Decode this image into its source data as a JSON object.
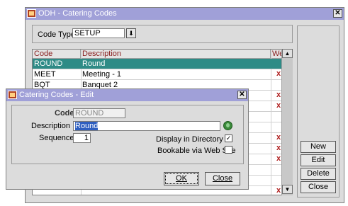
{
  "main_window": {
    "title": "ODH - Catering Codes",
    "close_glyph": "✕",
    "code_type": {
      "label": "Code Type",
      "value": "SETUP",
      "dropdown_glyph": "⬇"
    },
    "grid": {
      "columns": [
        "Code",
        "Description",
        "Web"
      ],
      "rows": [
        {
          "code": "ROUND",
          "description": "Round",
          "web": "",
          "selected": true
        },
        {
          "code": "MEET",
          "description": "Meeting - 1",
          "web": "x"
        },
        {
          "code": "BQT",
          "description": "Banquet 2",
          "web": ""
        },
        {
          "code": "",
          "description": "",
          "web": "x"
        },
        {
          "code": "",
          "description": "",
          "web": "x"
        },
        {
          "code": "",
          "description": "",
          "web": ""
        },
        {
          "code": "",
          "description": "",
          "web": ""
        },
        {
          "code": "",
          "description": "",
          "web": "x"
        },
        {
          "code": "",
          "description": "",
          "web": "x"
        },
        {
          "code": "",
          "description": "",
          "web": "x"
        },
        {
          "code": "",
          "description": "",
          "web": ""
        },
        {
          "code": "",
          "description": "",
          "web": ""
        },
        {
          "code": "",
          "description": "",
          "web": "x"
        }
      ],
      "scroll_up_glyph": "▲",
      "scroll_down_glyph": "▼"
    },
    "buttons": {
      "new": "New",
      "edit": "Edit",
      "delete": "Delete",
      "close": "Close"
    }
  },
  "edit_dialog": {
    "title": "Catering Codes - Edit",
    "close_glyph": "✕",
    "code": {
      "label": "Code",
      "value": "ROUND"
    },
    "description": {
      "label": "Description",
      "value": "Round"
    },
    "sequence": {
      "label": "Sequence",
      "value": "1"
    },
    "display_in_directory": {
      "label": "Display in Directory",
      "checked": true,
      "glyph": "✓"
    },
    "bookable_via_web": {
      "label": "Bookable via Web Site",
      "checked": false
    },
    "ok_label": "OK",
    "close_label": "Close"
  },
  "colors": {
    "title_bar": "#a0a0d8",
    "selected_row": "#2e8b86",
    "column_header_text": "#8b2020",
    "web_mark": "#b02020"
  }
}
